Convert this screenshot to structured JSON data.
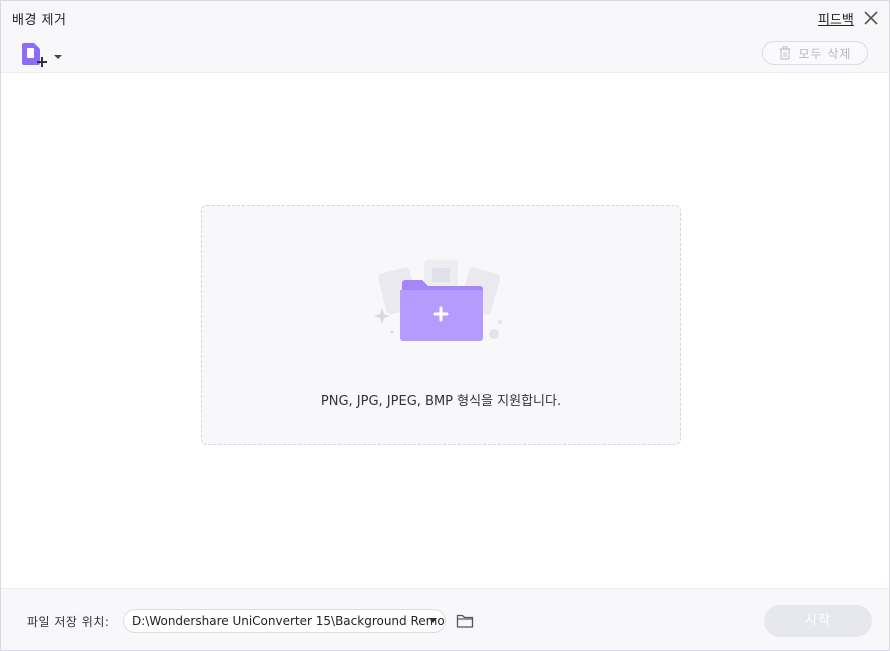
{
  "window": {
    "title": "배경 제거",
    "feedback_label": "피드백"
  },
  "toolbar": {
    "add_icon": "add-file-icon",
    "delete_all_label": "모두 삭제"
  },
  "dropzone": {
    "hint": "PNG, JPG, JPEG, BMP 형식을 지원합니다."
  },
  "footer": {
    "save_location_label": "파일 저장 위치:",
    "save_path": "D:\\Wondershare UniConverter 15\\Background Remo",
    "start_label": "시작"
  },
  "colors": {
    "accent": "#8f6cf6",
    "accent_light": "#b9a0ff",
    "disabled_button": "#e7e8ee"
  }
}
